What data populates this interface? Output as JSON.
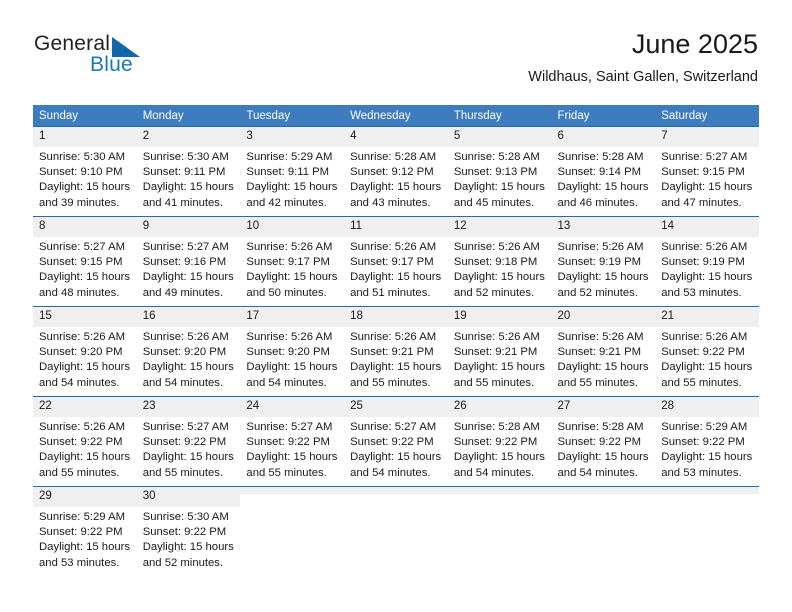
{
  "brand": {
    "name_part1": "General",
    "name_part2": "Blue",
    "triangle_color": "#1267ab",
    "blue_text_color": "#1878be"
  },
  "header": {
    "title": "June 2025",
    "subtitle": "Wildhaus, Saint Gallen, Switzerland"
  },
  "theme": {
    "header_row_bg": "#3c7cbf",
    "row_rule": "#1f6cb0",
    "daynum_bg": "#efefef"
  },
  "weekdays": [
    "Sunday",
    "Monday",
    "Tuesday",
    "Wednesday",
    "Thursday",
    "Friday",
    "Saturday"
  ],
  "weeks": [
    [
      {
        "day": "1",
        "sunrise": "Sunrise: 5:30 AM",
        "sunset": "Sunset: 9:10 PM",
        "daylight1": "Daylight: 15 hours",
        "daylight2": "and 39 minutes."
      },
      {
        "day": "2",
        "sunrise": "Sunrise: 5:30 AM",
        "sunset": "Sunset: 9:11 PM",
        "daylight1": "Daylight: 15 hours",
        "daylight2": "and 41 minutes."
      },
      {
        "day": "3",
        "sunrise": "Sunrise: 5:29 AM",
        "sunset": "Sunset: 9:11 PM",
        "daylight1": "Daylight: 15 hours",
        "daylight2": "and 42 minutes."
      },
      {
        "day": "4",
        "sunrise": "Sunrise: 5:28 AM",
        "sunset": "Sunset: 9:12 PM",
        "daylight1": "Daylight: 15 hours",
        "daylight2": "and 43 minutes."
      },
      {
        "day": "5",
        "sunrise": "Sunrise: 5:28 AM",
        "sunset": "Sunset: 9:13 PM",
        "daylight1": "Daylight: 15 hours",
        "daylight2": "and 45 minutes."
      },
      {
        "day": "6",
        "sunrise": "Sunrise: 5:28 AM",
        "sunset": "Sunset: 9:14 PM",
        "daylight1": "Daylight: 15 hours",
        "daylight2": "and 46 minutes."
      },
      {
        "day": "7",
        "sunrise": "Sunrise: 5:27 AM",
        "sunset": "Sunset: 9:15 PM",
        "daylight1": "Daylight: 15 hours",
        "daylight2": "and 47 minutes."
      }
    ],
    [
      {
        "day": "8",
        "sunrise": "Sunrise: 5:27 AM",
        "sunset": "Sunset: 9:15 PM",
        "daylight1": "Daylight: 15 hours",
        "daylight2": "and 48 minutes."
      },
      {
        "day": "9",
        "sunrise": "Sunrise: 5:27 AM",
        "sunset": "Sunset: 9:16 PM",
        "daylight1": "Daylight: 15 hours",
        "daylight2": "and 49 minutes."
      },
      {
        "day": "10",
        "sunrise": "Sunrise: 5:26 AM",
        "sunset": "Sunset: 9:17 PM",
        "daylight1": "Daylight: 15 hours",
        "daylight2": "and 50 minutes."
      },
      {
        "day": "11",
        "sunrise": "Sunrise: 5:26 AM",
        "sunset": "Sunset: 9:17 PM",
        "daylight1": "Daylight: 15 hours",
        "daylight2": "and 51 minutes."
      },
      {
        "day": "12",
        "sunrise": "Sunrise: 5:26 AM",
        "sunset": "Sunset: 9:18 PM",
        "daylight1": "Daylight: 15 hours",
        "daylight2": "and 52 minutes."
      },
      {
        "day": "13",
        "sunrise": "Sunrise: 5:26 AM",
        "sunset": "Sunset: 9:19 PM",
        "daylight1": "Daylight: 15 hours",
        "daylight2": "and 52 minutes."
      },
      {
        "day": "14",
        "sunrise": "Sunrise: 5:26 AM",
        "sunset": "Sunset: 9:19 PM",
        "daylight1": "Daylight: 15 hours",
        "daylight2": "and 53 minutes."
      }
    ],
    [
      {
        "day": "15",
        "sunrise": "Sunrise: 5:26 AM",
        "sunset": "Sunset: 9:20 PM",
        "daylight1": "Daylight: 15 hours",
        "daylight2": "and 54 minutes."
      },
      {
        "day": "16",
        "sunrise": "Sunrise: 5:26 AM",
        "sunset": "Sunset: 9:20 PM",
        "daylight1": "Daylight: 15 hours",
        "daylight2": "and 54 minutes."
      },
      {
        "day": "17",
        "sunrise": "Sunrise: 5:26 AM",
        "sunset": "Sunset: 9:20 PM",
        "daylight1": "Daylight: 15 hours",
        "daylight2": "and 54 minutes."
      },
      {
        "day": "18",
        "sunrise": "Sunrise: 5:26 AM",
        "sunset": "Sunset: 9:21 PM",
        "daylight1": "Daylight: 15 hours",
        "daylight2": "and 55 minutes."
      },
      {
        "day": "19",
        "sunrise": "Sunrise: 5:26 AM",
        "sunset": "Sunset: 9:21 PM",
        "daylight1": "Daylight: 15 hours",
        "daylight2": "and 55 minutes."
      },
      {
        "day": "20",
        "sunrise": "Sunrise: 5:26 AM",
        "sunset": "Sunset: 9:21 PM",
        "daylight1": "Daylight: 15 hours",
        "daylight2": "and 55 minutes."
      },
      {
        "day": "21",
        "sunrise": "Sunrise: 5:26 AM",
        "sunset": "Sunset: 9:22 PM",
        "daylight1": "Daylight: 15 hours",
        "daylight2": "and 55 minutes."
      }
    ],
    [
      {
        "day": "22",
        "sunrise": "Sunrise: 5:26 AM",
        "sunset": "Sunset: 9:22 PM",
        "daylight1": "Daylight: 15 hours",
        "daylight2": "and 55 minutes."
      },
      {
        "day": "23",
        "sunrise": "Sunrise: 5:27 AM",
        "sunset": "Sunset: 9:22 PM",
        "daylight1": "Daylight: 15 hours",
        "daylight2": "and 55 minutes."
      },
      {
        "day": "24",
        "sunrise": "Sunrise: 5:27 AM",
        "sunset": "Sunset: 9:22 PM",
        "daylight1": "Daylight: 15 hours",
        "daylight2": "and 55 minutes."
      },
      {
        "day": "25",
        "sunrise": "Sunrise: 5:27 AM",
        "sunset": "Sunset: 9:22 PM",
        "daylight1": "Daylight: 15 hours",
        "daylight2": "and 54 minutes."
      },
      {
        "day": "26",
        "sunrise": "Sunrise: 5:28 AM",
        "sunset": "Sunset: 9:22 PM",
        "daylight1": "Daylight: 15 hours",
        "daylight2": "and 54 minutes."
      },
      {
        "day": "27",
        "sunrise": "Sunrise: 5:28 AM",
        "sunset": "Sunset: 9:22 PM",
        "daylight1": "Daylight: 15 hours",
        "daylight2": "and 54 minutes."
      },
      {
        "day": "28",
        "sunrise": "Sunrise: 5:29 AM",
        "sunset": "Sunset: 9:22 PM",
        "daylight1": "Daylight: 15 hours",
        "daylight2": "and 53 minutes."
      }
    ],
    [
      {
        "day": "29",
        "sunrise": "Sunrise: 5:29 AM",
        "sunset": "Sunset: 9:22 PM",
        "daylight1": "Daylight: 15 hours",
        "daylight2": "and 53 minutes."
      },
      {
        "day": "30",
        "sunrise": "Sunrise: 5:30 AM",
        "sunset": "Sunset: 9:22 PM",
        "daylight1": "Daylight: 15 hours",
        "daylight2": "and 52 minutes."
      },
      {
        "day": "",
        "sunrise": "",
        "sunset": "",
        "daylight1": "",
        "daylight2": ""
      },
      {
        "day": "",
        "sunrise": "",
        "sunset": "",
        "daylight1": "",
        "daylight2": ""
      },
      {
        "day": "",
        "sunrise": "",
        "sunset": "",
        "daylight1": "",
        "daylight2": ""
      },
      {
        "day": "",
        "sunrise": "",
        "sunset": "",
        "daylight1": "",
        "daylight2": ""
      },
      {
        "day": "",
        "sunrise": "",
        "sunset": "",
        "daylight1": "",
        "daylight2": ""
      }
    ]
  ]
}
